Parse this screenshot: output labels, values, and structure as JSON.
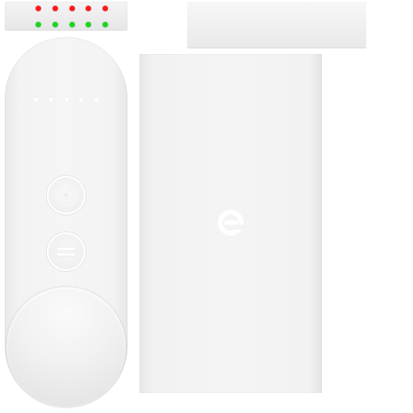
{
  "led_strip": {
    "top_leds": [
      "#ff1a1a",
      "#ff1a1a",
      "#ff1a1a",
      "#ff1a1a",
      "#ff1a1a"
    ],
    "bottom_leds": [
      "#1ed41e",
      "#1ed41e",
      "#1ed41e",
      "#1ed41e",
      "#1ed41e"
    ]
  },
  "remote": {
    "indicator_dot_count": 5,
    "buttons": [
      {
        "icon": "target-icon"
      },
      {
        "icon": "equals-icon"
      }
    ],
    "knob": {
      "icon": "dial-knob"
    }
  },
  "hub": {
    "logo_icon": "e-logo-icon"
  },
  "colors": {
    "body": "#f3f3f3",
    "led_red": "#ff1a1a",
    "led_green": "#1ed41e",
    "logo": "#ffffff"
  }
}
